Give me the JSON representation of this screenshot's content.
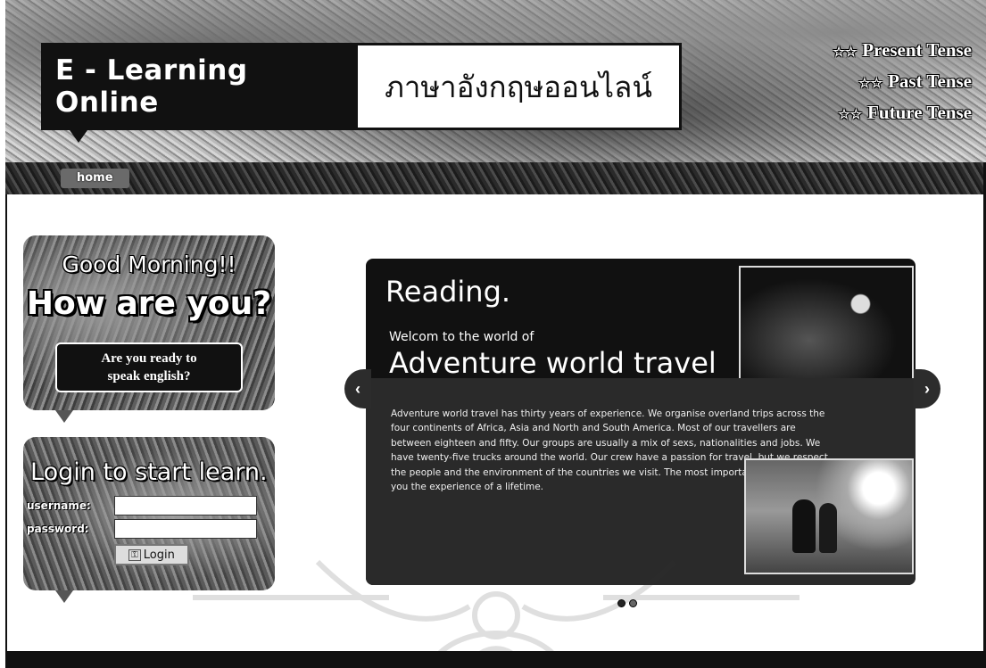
{
  "header": {
    "logo_en": "E - Learning Online",
    "logo_th": "ภาษาอังกฤษออนไลน์",
    "tenses": [
      {
        "star": "☆☆",
        "label": "Present Tense"
      },
      {
        "star": "☆☆",
        "label": "Past Tense"
      },
      {
        "star": "☆☆",
        "label": "Future Tense"
      }
    ]
  },
  "nav": {
    "items": [
      {
        "label": "home",
        "active": true
      },
      {
        "label": "",
        "active": false
      },
      {
        "label": "",
        "active": false
      },
      {
        "label": "",
        "active": false
      },
      {
        "label": "",
        "active": false
      }
    ]
  },
  "greeting": {
    "line1": "Good Morning!!",
    "line2": "How are you?",
    "button": "Are you ready to\nspeak english?"
  },
  "login": {
    "title": "Login to start learn.",
    "username_label": "username:",
    "password_label": "password:",
    "username_value": "",
    "password_value": "",
    "button": "Login"
  },
  "slider": {
    "title": "Reading.",
    "welcome": "Welcom to the world of",
    "headline": "Adventure world travel",
    "body": "Adventure world travel has thirty years of experience. We organise overland trips across the four continents of Africa, Asia and North and South America. Most of our travellers are between eighteen and fifty. Our groups are usually a mix of sexs, nationalities and jobs. We have twenty-five trucks around the world. Our crew have a passion for travel, but we respect the people and the environment of the countries we visit. The most important thing is to give you the experience of a lifetime.",
    "prev_arrow": "‹",
    "next_arrow": "›",
    "dots": 2,
    "active_dot": 1
  }
}
